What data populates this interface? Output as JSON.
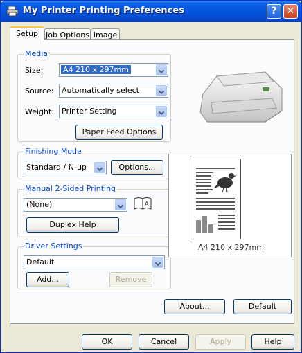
{
  "window": {
    "title": "My Printer Printing Preferences",
    "help": "?",
    "close": "✕"
  },
  "tabs": [
    "Setup",
    "Job Options",
    "Image"
  ],
  "media": {
    "title": "Media",
    "size_label": "Size:",
    "size_value": "A4 210 x 297mm",
    "source_label": "Source:",
    "source_value": "Automatically select",
    "weight_label": "Weight:",
    "weight_value": "Printer Setting",
    "paper_feed_button": "Paper Feed Options"
  },
  "finishing": {
    "title": "Finishing Mode",
    "value": "Standard / N-up",
    "options_button": "Options..."
  },
  "duplex": {
    "title": "Manual 2-Sided Printing",
    "value": "(None)",
    "help_button": "Duplex Help",
    "book_glyph": "A"
  },
  "driver": {
    "title": "Driver Settings",
    "value": "Default",
    "add_button": "Add...",
    "remove_button": "Remove"
  },
  "preview": {
    "caption": "A4 210 x 297mm"
  },
  "buttons": {
    "about": "About...",
    "default": "Default"
  },
  "footer": {
    "ok": "OK",
    "cancel": "Cancel",
    "apply": "Apply",
    "help": "Help"
  },
  "colors": {
    "title_bar": "#0551db",
    "group_title": "#0046d5",
    "selection": "#316ac5"
  }
}
